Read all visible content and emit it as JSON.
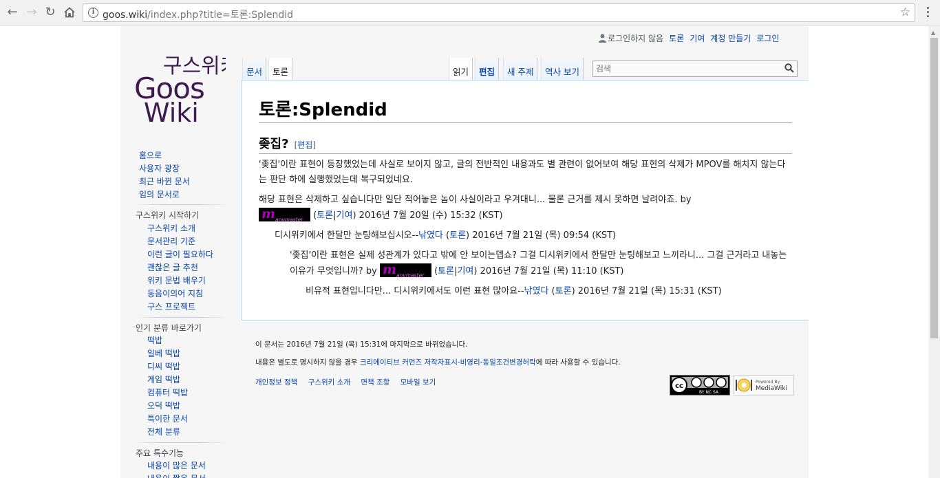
{
  "browser": {
    "url_host": "goos.wiki",
    "url_path": "/index.php?title=토론:Splendid"
  },
  "personal_tools": {
    "anon": "로그인하지 않음",
    "talk": "토론",
    "contributions": "기여",
    "create_account": "계정 만들기",
    "login": "로그인"
  },
  "tabs": {
    "article": "문서",
    "talk": "토론",
    "read": "읽기",
    "edit": "편집",
    "new_section": "새 주제",
    "history": "역사 보기"
  },
  "search": {
    "placeholder": "검색"
  },
  "logo": {
    "line1": "구스위키",
    "line2": "Goos",
    "line3": "Wiki"
  },
  "page": {
    "title_ns": "토론",
    "title_sep": ":",
    "title_name": "Splendid",
    "section_title": "좆집?",
    "section_edit_open": "[",
    "section_edit": "편집",
    "section_edit_close": "]",
    "comments": [
      {
        "text": "'좆집'이란 표현이 등장했었는데 사실로 보이지 않고, 글의 전반적인 내용과도 별 관련이 없어보여 해당 표현의 삭제가 MPOV를 해치지 않는다는 판단 하에 실행했었는데 복구되었네요."
      },
      {
        "text": "해당 표현은 삭제하고 싶습니다만 일단 적어놓은 놈이 사실이라고 우겨대니... 물론 근거를 제시 못하면 날려야죠. by",
        "sig_talk": "토론",
        "sig_sep": "|",
        "sig_contrib": "기여",
        "time": "2016년 7월 20일 (수) 15:32 (KST)"
      },
      {
        "text": "디시위키에서 한달만 눈팅해보십시오--",
        "user": "낚였다",
        "talk": "토론",
        "time": "2016년 7월 21일 (목) 09:54 (KST)"
      },
      {
        "text": "'좆집'이란 표현은 실제 성관계가 있다고 밖에 안 보이는뎁쇼? 그걸 디시위키에서 한달만 눈팅해보고 느끼라니... 그걸 근거라고 내놓는 이유가 무엇입니까? by",
        "sig_talk": "토론",
        "sig_sep": "|",
        "sig_contrib": "기여",
        "time": "2016년 7월 21일 (목) 11:10 (KST)"
      },
      {
        "text": "비유적 표현입니다만... 디시위키에서도 이런 표현 많아요--",
        "user": "낚였다",
        "talk": "토론",
        "time": "2016년 7월 21일 (목) 15:31 (KST)"
      }
    ],
    "sig_image_text": "anymaster"
  },
  "sidebar": {
    "main": [
      "홈으로",
      "사용자 광장",
      "최근 바뀐 문서",
      "임의 문서로"
    ],
    "start_heading": "구스위키 시작하기",
    "start": [
      "구스위키 소개",
      "문서관리 기준",
      "이런 글이 필요하다",
      "괜찮은 글 추천",
      "위키 문법 배우기",
      "동음이의어 지침",
      "구스 프로젝트"
    ],
    "popular_heading": "인기 분류 바로가기",
    "popular": [
      "떡밥",
      "일베 떡밥",
      "디씨 떡밥",
      "게임 떡밥",
      "컴퓨터 떡밥",
      "오덕 떡밥",
      "특이한 문서",
      "전체 분류"
    ],
    "special_heading": "주요 특수기능",
    "special": [
      "내용이 많은 문서",
      "내용이 짧은 문서"
    ]
  },
  "footer": {
    "lastmod": "이 문서는 2016년 7월 21일 (목) 15:31에 마지막으로 바뀌었습니다.",
    "license_pre": "내용은 별도로 명시하지 않을 경우 ",
    "license_link": "크리에이티브 커먼즈 저작자표시-비영리-동일조건변경허락",
    "license_post": "에 따라 사용할 수 있습니다.",
    "links": [
      "개인정보 정책",
      "구스위키 소개",
      "면책 조항",
      "모바일 보기"
    ],
    "cc_text": "BY NC SA",
    "mw_powered": "Powered By",
    "mw_name": "MediaWiki"
  },
  "colors": {
    "link": "#0645ad",
    "border": "#a7d7f9",
    "logo": "#3d1a4e"
  }
}
